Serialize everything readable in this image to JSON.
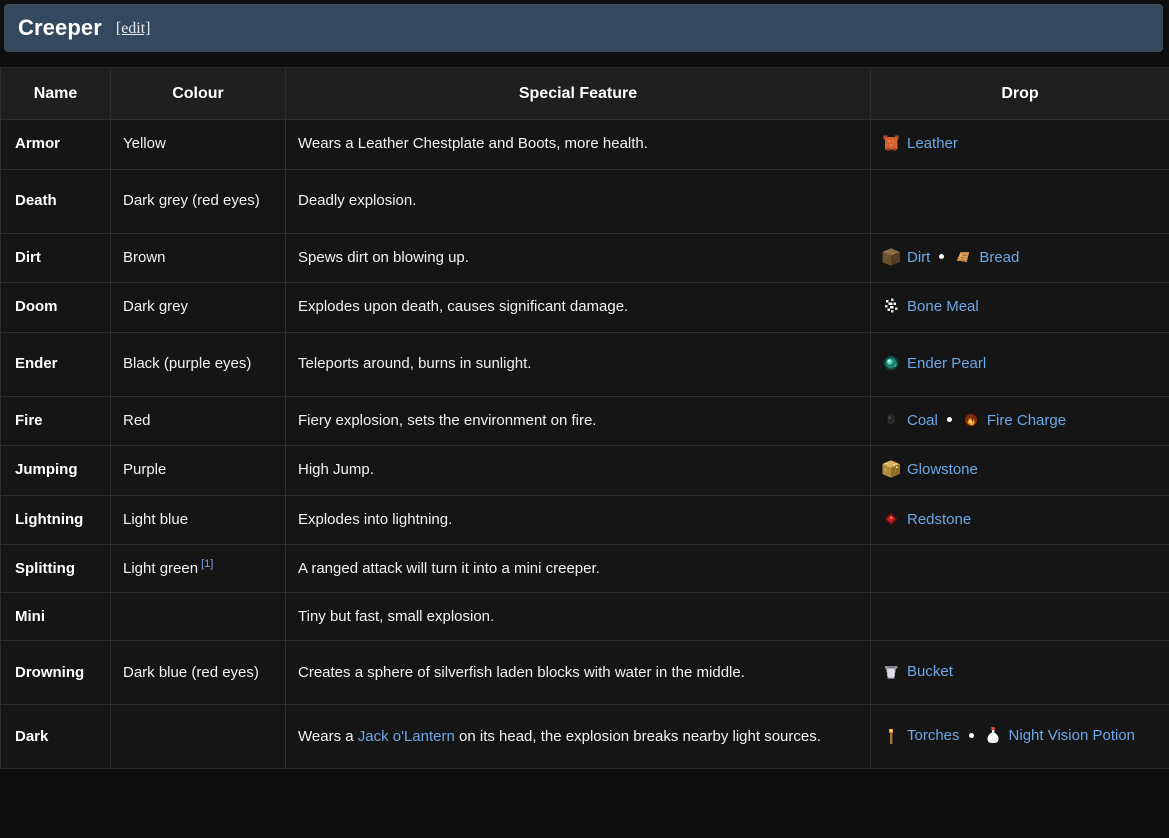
{
  "heading": {
    "title": "Creeper",
    "edit_label": "[edit]"
  },
  "colors": {
    "heading_bg": "#34495e",
    "page_bg": "#0e0e0e",
    "table_bg": "#151515",
    "header_row_bg": "#1f1f1f",
    "border": "#2e2e2e",
    "link": "#6da8e8",
    "text": "#f2f2f2"
  },
  "table": {
    "columns": [
      "Name",
      "Colour",
      "Special Feature",
      "Drop"
    ],
    "rows": [
      {
        "name": "Armor",
        "colour": "Yellow",
        "feature": "Wears a Leather Chestplate and Boots, more health.",
        "drops": [
          {
            "label": "Leather",
            "icon": "leather-icon"
          }
        ]
      },
      {
        "name": "Death",
        "colour": "Dark grey (red eyes)",
        "feature": "Deadly explosion.",
        "drops": []
      },
      {
        "name": "Dirt",
        "colour": "Brown",
        "feature": "Spews dirt on blowing up.",
        "drops": [
          {
            "label": "Dirt",
            "icon": "dirt-block-icon"
          },
          {
            "label": "Bread",
            "icon": "bread-icon"
          }
        ]
      },
      {
        "name": "Doom",
        "colour": "Dark grey",
        "feature": "Explodes upon death, causes significant damage.",
        "drops": [
          {
            "label": "Bone Meal",
            "icon": "bone-meal-icon"
          }
        ]
      },
      {
        "name": "Ender",
        "colour": "Black (purple eyes)",
        "feature": "Teleports around, burns in sunlight.",
        "drops": [
          {
            "label": "Ender Pearl",
            "icon": "ender-pearl-icon"
          }
        ]
      },
      {
        "name": "Fire",
        "colour": "Red",
        "feature": "Fiery explosion, sets the environment on fire.",
        "drops": [
          {
            "label": "Coal",
            "icon": "coal-icon"
          },
          {
            "label": "Fire Charge",
            "icon": "fire-charge-icon"
          }
        ]
      },
      {
        "name": "Jumping",
        "colour": "Purple",
        "feature": "High Jump.",
        "drops": [
          {
            "label": "Glowstone",
            "icon": "glowstone-icon"
          }
        ]
      },
      {
        "name": "Lightning",
        "colour": "Light blue",
        "feature": "Explodes into lightning.",
        "drops": [
          {
            "label": "Redstone",
            "icon": "redstone-icon"
          }
        ]
      },
      {
        "name": "Splitting",
        "colour": "Light green",
        "colour_ref": "[1]",
        "feature": "A ranged attack will turn it into a mini creeper.",
        "drops": []
      },
      {
        "name": "Mini",
        "colour": "",
        "feature": "Tiny but fast, small explosion.",
        "drops": []
      },
      {
        "name": "Drowning",
        "colour": "Dark blue (red eyes)",
        "feature": "Creates a sphere of silverfish laden blocks with water in the middle.",
        "drops": [
          {
            "label": "Bucket",
            "icon": "bucket-icon"
          }
        ]
      },
      {
        "name": "Dark",
        "colour": "",
        "feature_parts": [
          {
            "text": "Wears a ",
            "link": false
          },
          {
            "text": "Jack o'Lantern",
            "link": true
          },
          {
            "text": " on its head, the explosion breaks nearby light sources.",
            "link": false
          }
        ],
        "feature": "Wears a Jack o'Lantern on its head, the explosion breaks nearby light sources.",
        "drops": [
          {
            "label": "Torches",
            "icon": "torch-icon"
          },
          {
            "label": "Night Vision Potion",
            "icon": "potion-icon"
          }
        ]
      }
    ]
  }
}
